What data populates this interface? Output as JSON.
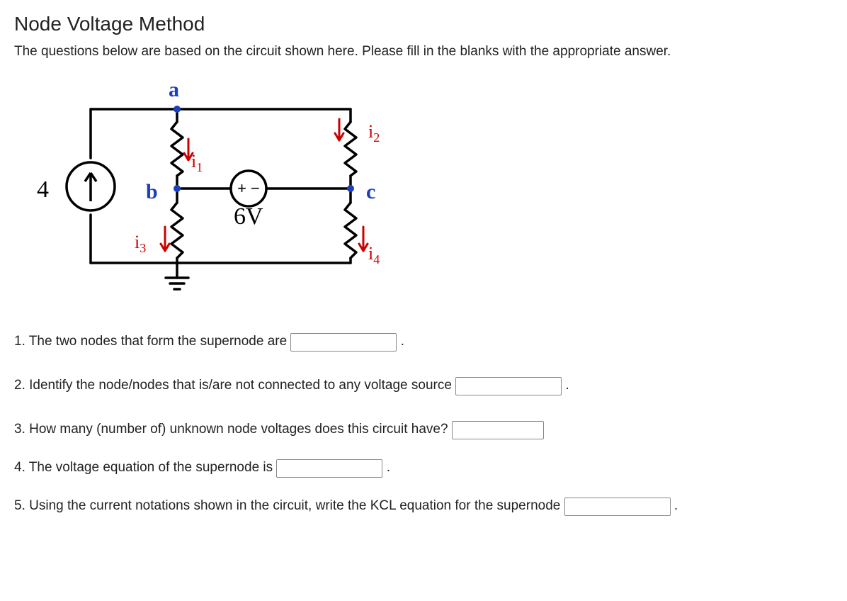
{
  "title": "Node Voltage Method",
  "lead": "The questions below are based on the circuit shown here. Please fill in the blanks with the appropriate answer.",
  "circuit": {
    "nodes": [
      "a",
      "b",
      "c"
    ],
    "current_source": "4",
    "voltage_source": "6V",
    "voltage_polarity": "+ -",
    "currents": [
      "i1",
      "i2",
      "i3",
      "i4"
    ]
  },
  "questions": {
    "q1_pre": "1. The two nodes that form the supernode are",
    "q1_post": ".",
    "q2_pre": "2. Identify the node/nodes that is/are not connected to any voltage source",
    "q2_post": ".",
    "q3_pre": "3. How many (number of) unknown node voltages does this circuit have?",
    "q4_pre": "4. The voltage equation of the supernode is",
    "q4_post": ".",
    "q5_pre": "5. Using the current notations shown in the circuit, write the KCL equation for the supernode",
    "q5_post": "."
  }
}
